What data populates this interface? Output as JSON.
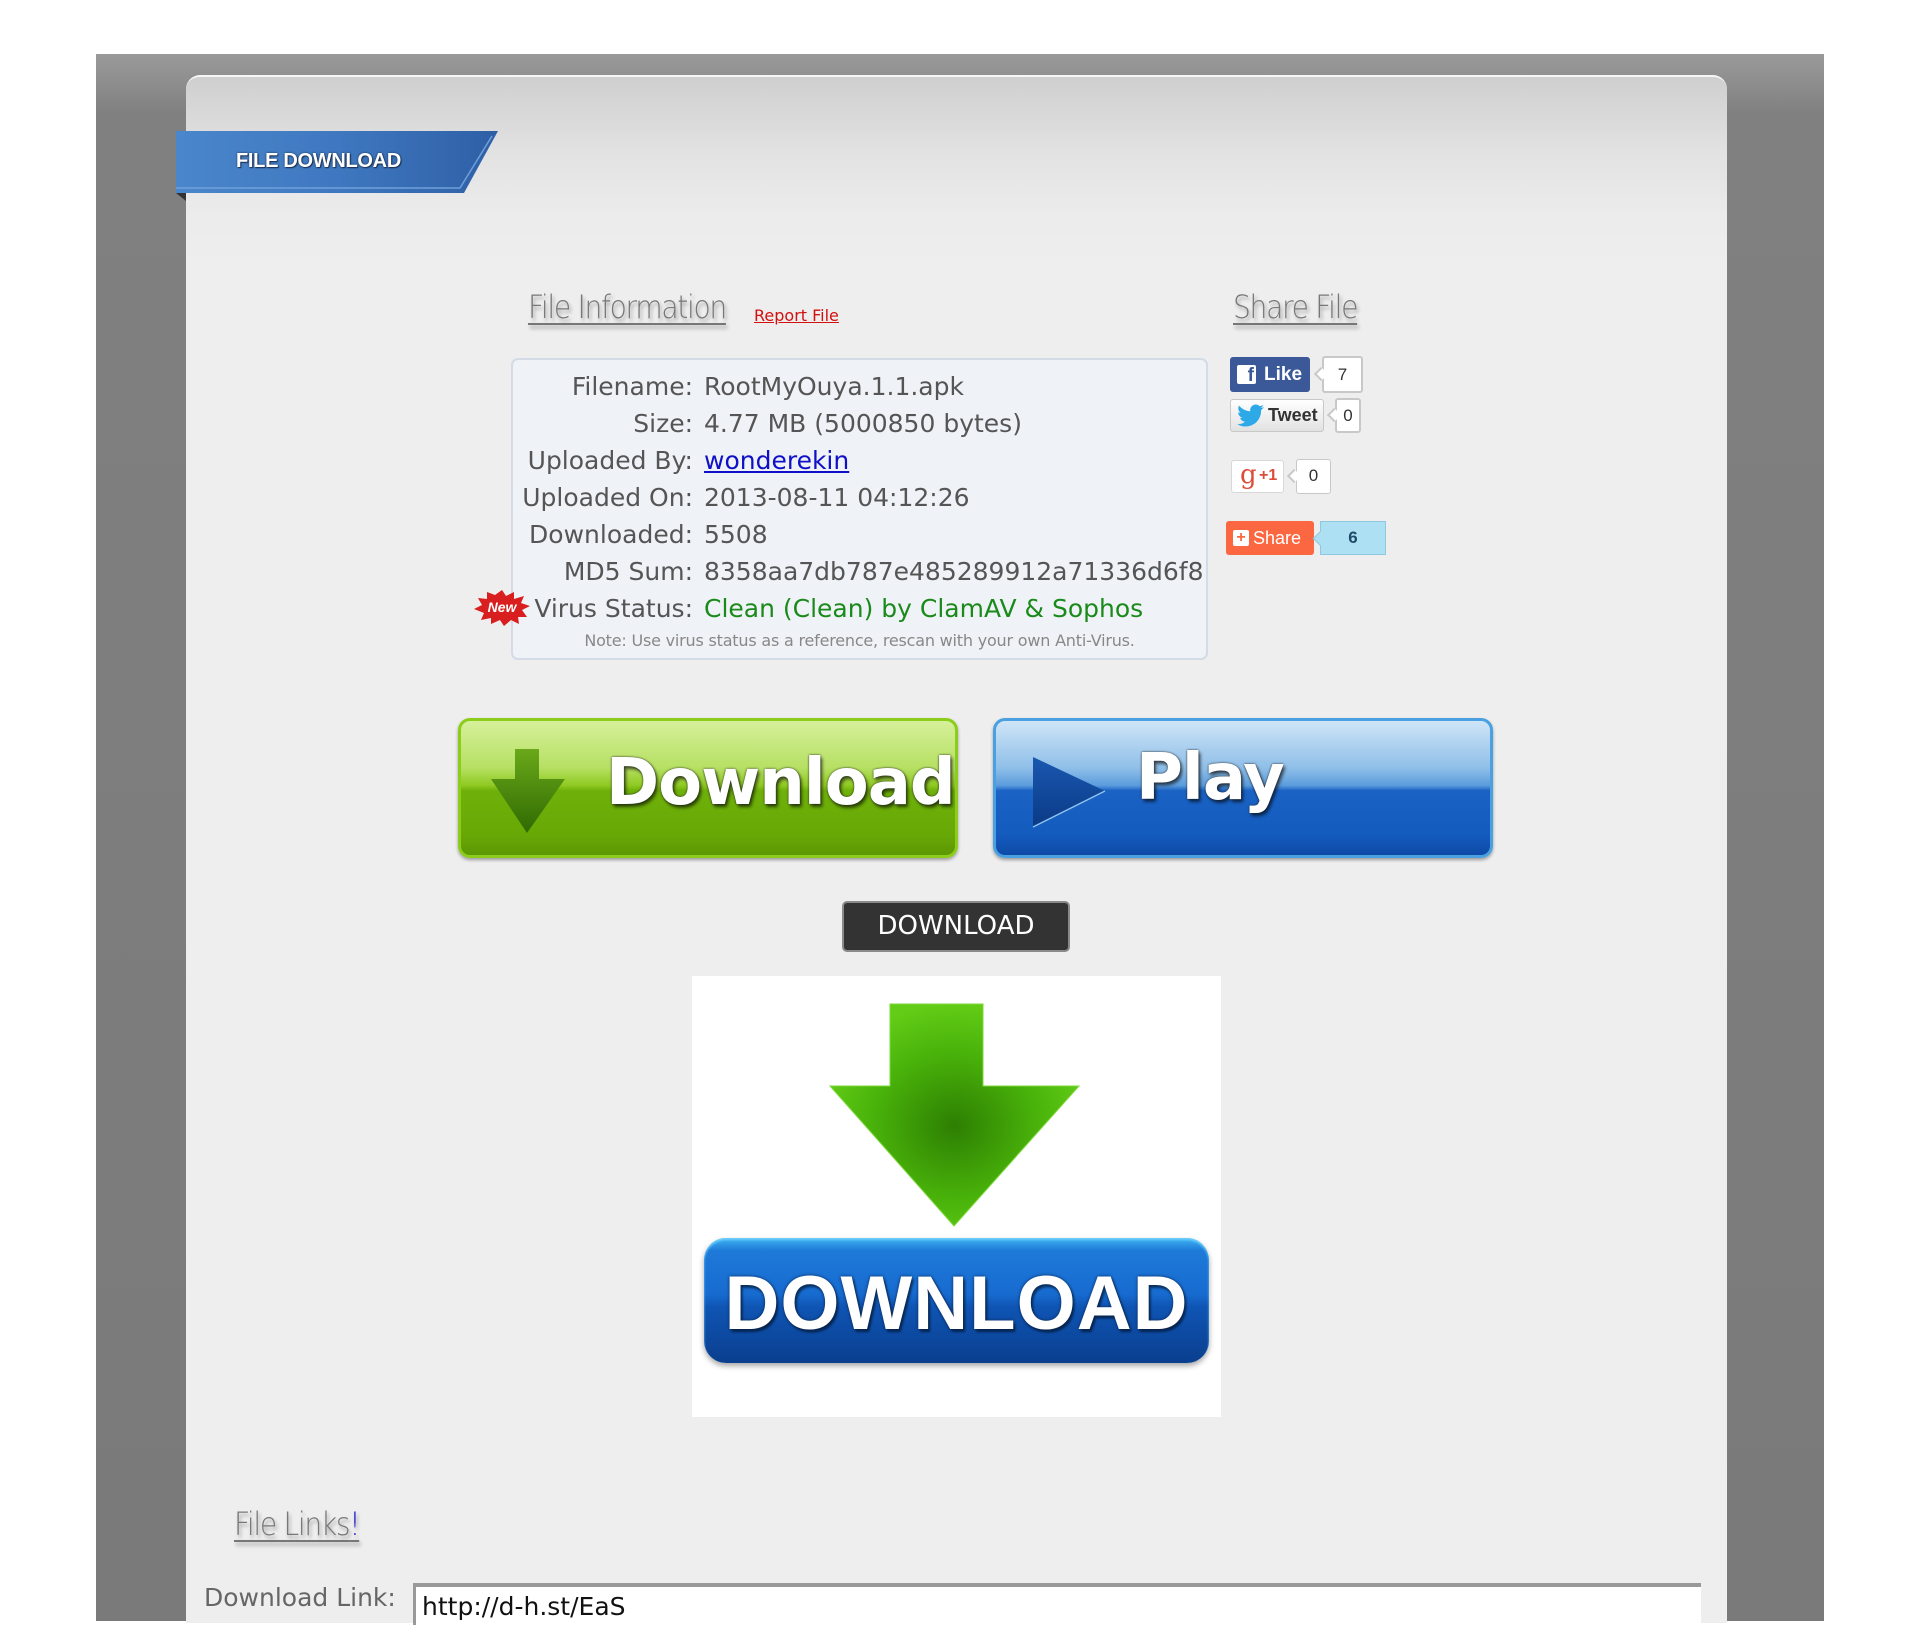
{
  "header": {
    "ribbon_title": "FILE DOWNLOAD"
  },
  "file_info": {
    "heading": "File Information",
    "report_link": "Report File",
    "rows": [
      {
        "label": "Filename:",
        "value": "RootMyOuya.1.1.apk"
      },
      {
        "label": "Size:",
        "value": "4.77 MB (5000850 bytes)"
      },
      {
        "label": "Uploaded By:",
        "value": "wonderekin"
      },
      {
        "label": "Uploaded On:",
        "value": "2013-08-11 04:12:26"
      },
      {
        "label": "Downloaded:",
        "value": "5508"
      },
      {
        "label": "MD5 Sum:",
        "value": "8358aa7db787e485289912a71336d6f8"
      },
      {
        "label": "Virus Status:",
        "value": "Clean (Clean) by ClamAV & Sophos"
      }
    ],
    "new_badge": "New",
    "note": "Note: Use virus status as a reference, rescan with your own Anti-Virus."
  },
  "share": {
    "heading": "Share File",
    "facebook": {
      "label": "Like",
      "count": "7"
    },
    "twitter": {
      "label": "Tweet",
      "count": "0"
    },
    "gplus": {
      "label": "+1",
      "glyph": "g",
      "count": "0"
    },
    "addthis": {
      "label": "Share",
      "count": "6"
    }
  },
  "buttons": {
    "download_big": "Download",
    "play_big": "Play",
    "download_dark": "DOWNLOAD",
    "download_image": "DOWNLOAD"
  },
  "links": {
    "heading": "File Links",
    "heading_suffix": "!",
    "download_label": "Download Link:",
    "download_value": "http://d-h.st/EaS"
  },
  "colors": {
    "ribbon": "#3f78c0",
    "report_link": "#d21010",
    "virus_clean": "#1a8a1a",
    "facebook": "#3b5998",
    "share": "#fa6740"
  }
}
